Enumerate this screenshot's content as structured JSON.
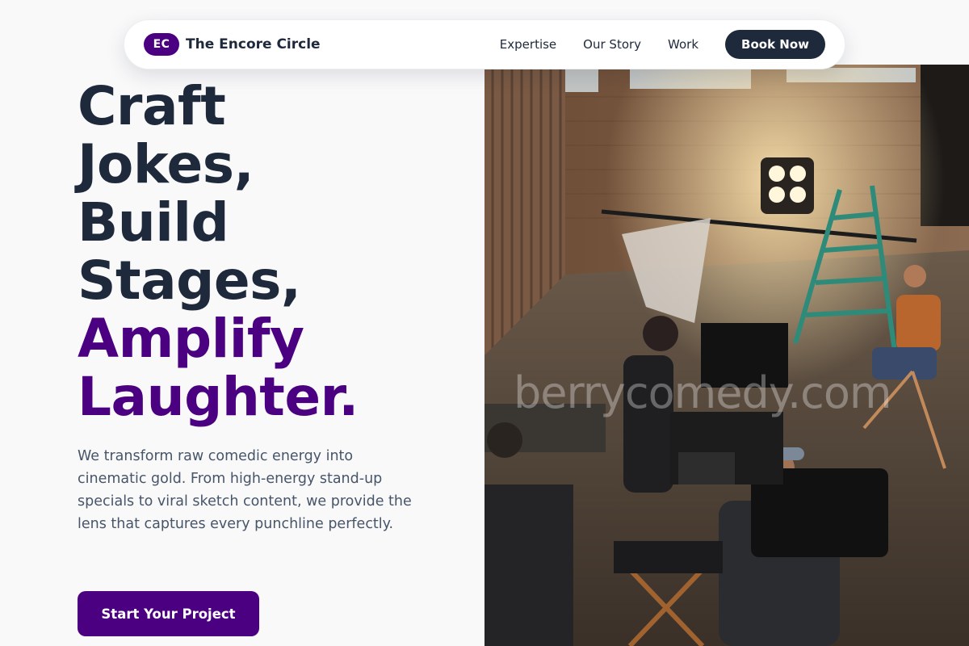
{
  "brand": {
    "logo_initials": "EC",
    "name": "The Encore Circle"
  },
  "nav": {
    "links": [
      "Expertise",
      "Our Story",
      "Work"
    ],
    "cta_label": "Book Now"
  },
  "hero": {
    "headline_lines": [
      "Craft",
      "Jokes,",
      "Build",
      "Stages,"
    ],
    "headline_accent_lines": [
      "Amplify",
      "Laughter."
    ],
    "description": "We transform raw comedic energy into cinematic gold. From high-energy stand-up specials to viral sketch content, we provide the lens that captures every punchline perfectly.",
    "cta_label": "Start Your Project",
    "image_watermark": "berrycomedy.com"
  },
  "colors": {
    "accent": "#4b0082",
    "dark": "#1e293b",
    "body_text": "#475569",
    "background": "#f9f9fa"
  }
}
